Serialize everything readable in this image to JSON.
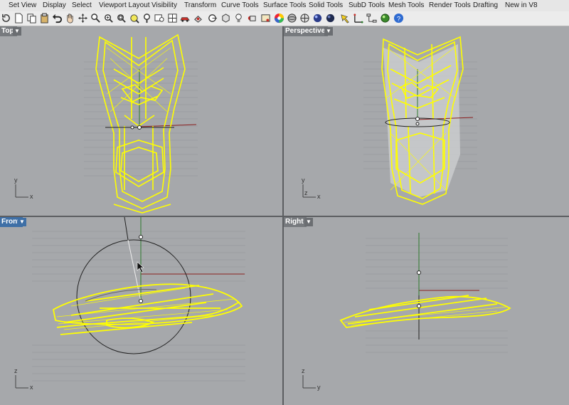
{
  "menu": {
    "tabs": [
      "Set View",
      "Display",
      "Select",
      "Viewport Layout",
      "Visibility",
      "Transform",
      "Curve Tools",
      "Surface Tools",
      "Solid Tools",
      "SubD Tools",
      "Mesh Tools",
      "Render Tools",
      "Drafting",
      "New in V8"
    ]
  },
  "toolbar": {
    "icons": [
      "rotate-view-icon",
      "new-file-icon",
      "paste-icon",
      "undo-icon",
      "pan-hand-icon",
      "move-icon",
      "zoom-icon",
      "zoom-window-icon",
      "zoom-extents-icon",
      "zoom-selected-icon",
      "lightbulb-icon",
      "named-views-icon",
      "car-icon",
      "box-select-icon",
      "point-snap-icon",
      "grid-icon",
      "light-icon",
      "render-icon",
      "color-wheel-icon",
      "sphere-icon",
      "globe-icon",
      "metal-sphere-icon",
      "pen-tool-icon",
      "gumball-icon",
      "network-icon",
      "green-sphere-icon",
      "help-icon"
    ]
  },
  "viewports": {
    "top": {
      "label": "Top",
      "axis_h": "x",
      "axis_v": "y"
    },
    "perspective": {
      "label": "Perspective",
      "axis_h": "x",
      "axis_v": "y",
      "axis_z": "z"
    },
    "front": {
      "label": "Front",
      "axis_h": "x",
      "axis_v": "z"
    },
    "right": {
      "label": "Right",
      "axis_h": "y",
      "axis_v": "z"
    }
  },
  "colors": {
    "wire": "#ffff00",
    "active_label": "#3e6fa6",
    "inactive_label": "#777a7e",
    "viewport_bg": "#a6a8ab",
    "x_axis": "#8b1f1f",
    "y_axis": "#2e7a2e"
  }
}
